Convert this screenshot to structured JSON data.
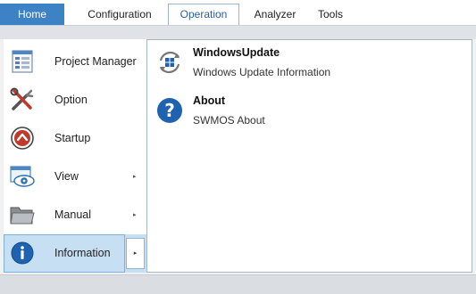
{
  "ribbon": {
    "tabs": [
      {
        "label": "Home"
      },
      {
        "label": "Configuration"
      },
      {
        "label": "Operation"
      },
      {
        "label": "Analyzer"
      },
      {
        "label": "Tools"
      }
    ],
    "active_tab": "Operation",
    "accent_color": "#3c82c4"
  },
  "nav": {
    "items": [
      {
        "label": "Project Manager",
        "icon": "project-manager-icon",
        "has_submenu": false
      },
      {
        "label": "Option",
        "icon": "tools-icon",
        "has_submenu": false
      },
      {
        "label": "Startup",
        "icon": "startup-icon",
        "has_submenu": false
      },
      {
        "label": "View",
        "icon": "view-icon",
        "has_submenu": true
      },
      {
        "label": "Manual",
        "icon": "folder-icon",
        "has_submenu": true
      },
      {
        "label": "Information",
        "icon": "info-icon",
        "has_submenu": true,
        "selected": true
      }
    ],
    "submenu_arrow": "▸",
    "selected_color": "#c6dff3"
  },
  "content": {
    "entries": [
      {
        "title": "WindowsUpdate",
        "description": "Windows Update Information",
        "icon": "windows-update-icon"
      },
      {
        "title": "About",
        "description": "SWMOS About",
        "icon": "help-icon"
      }
    ]
  }
}
